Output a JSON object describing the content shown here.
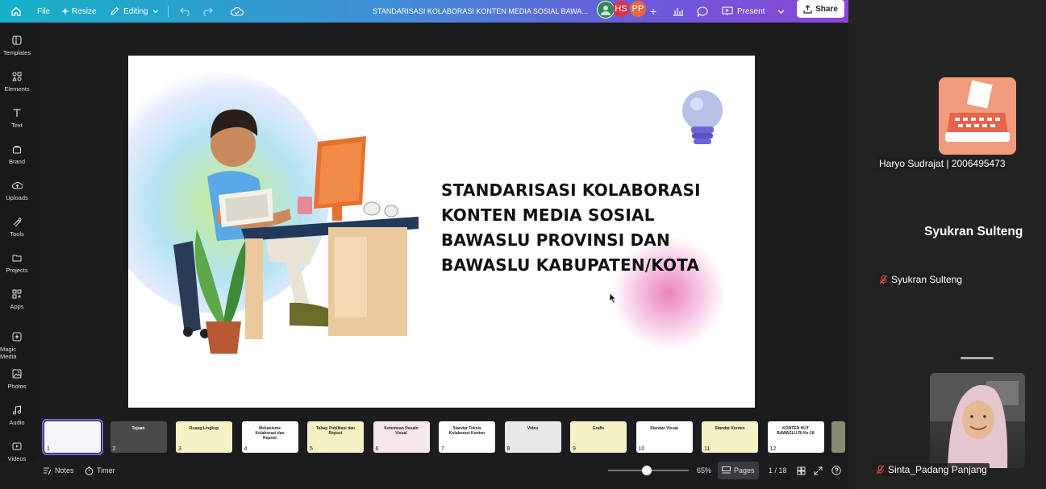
{
  "topbar": {
    "file_label": "File",
    "resize_label": "Resize",
    "editing_label": "Editing",
    "doc_title": "STANDARISASI KOLABORASI KONTEN MEDIA SOSIAL BAWA...",
    "avatars": [
      {
        "initials": "",
        "color": "#2e8b57"
      },
      {
        "initials": "HS",
        "color": "#e0314b"
      },
      {
        "initials": "PP",
        "color": "#f0663d"
      }
    ],
    "present_label": "Present",
    "share_label": "Share",
    "colors": {
      "gradient_start": "#16b1c9",
      "gradient_end": "#8a45d6"
    }
  },
  "sidebar": {
    "items": [
      {
        "label": "Templates",
        "icon": "templates-icon"
      },
      {
        "label": "Elements",
        "icon": "elements-icon"
      },
      {
        "label": "Text",
        "icon": "text-icon"
      },
      {
        "label": "Brand",
        "icon": "brand-icon"
      },
      {
        "label": "Uploads",
        "icon": "uploads-icon"
      },
      {
        "label": "Tools",
        "icon": "tools-icon"
      },
      {
        "label": "Projects",
        "icon": "projects-icon"
      },
      {
        "label": "Apps",
        "icon": "apps-icon"
      },
      {
        "label": "Magic Media",
        "icon": "magic-media-icon"
      },
      {
        "label": "Photos",
        "icon": "photos-icon"
      },
      {
        "label": "Audio",
        "icon": "audio-icon"
      },
      {
        "label": "Videos",
        "icon": "videos-icon"
      }
    ]
  },
  "slide": {
    "title_lines": [
      "STANDARISASI KOLABORASI",
      "KONTEN MEDIA SOSIAL",
      "BAWASLU PROVINSI DAN",
      "BAWASLU KABUPATEN/KOTA"
    ]
  },
  "thumbnails": [
    {
      "num": "1",
      "title": "",
      "style": "light",
      "selected": true
    },
    {
      "num": "2",
      "title": "Tujuan",
      "style": "dark",
      "selected": false
    },
    {
      "num": "3",
      "title": "Ruang Lingkup",
      "style": "yellow",
      "selected": false
    },
    {
      "num": "4",
      "title": "Mekanisme Kolaborasi dan Repost",
      "style": "white",
      "selected": false
    },
    {
      "num": "5",
      "title": "Tahap Publikasi dan Repost",
      "style": "yellow",
      "selected": false
    },
    {
      "num": "6",
      "title": "Ketentuan Desain Visual",
      "style": "pink",
      "selected": false
    },
    {
      "num": "7",
      "title": "Standar Teknis Kolaborasi Konten",
      "style": "white",
      "selected": false
    },
    {
      "num": "8",
      "title": "Video",
      "style": "gray",
      "selected": false
    },
    {
      "num": "9",
      "title": "Grafis",
      "style": "yellow",
      "selected": false
    },
    {
      "num": "10",
      "title": "Standar Visual",
      "style": "white",
      "selected": false
    },
    {
      "num": "11",
      "title": "Standar Konten",
      "style": "yellow",
      "selected": false
    },
    {
      "num": "12",
      "title": "KONTEN HUT BAWASLU RI Ke-18",
      "style": "white",
      "selected": false
    }
  ],
  "bottombar": {
    "notes_label": "Notes",
    "timer_label": "Timer",
    "zoom": "65%",
    "zoom_fraction": 0.48,
    "pages_label": "Pages",
    "page_counter": "1 / 18"
  },
  "participants": [
    {
      "name": "Haryo Sudrajat  | 2006495473",
      "muted": false
    },
    {
      "name": "Syukran Sulteng",
      "muted": true,
      "display_name": "Syukran Sulteng"
    },
    {
      "name": "Sinta_Padang Panjang",
      "muted": true
    }
  ]
}
